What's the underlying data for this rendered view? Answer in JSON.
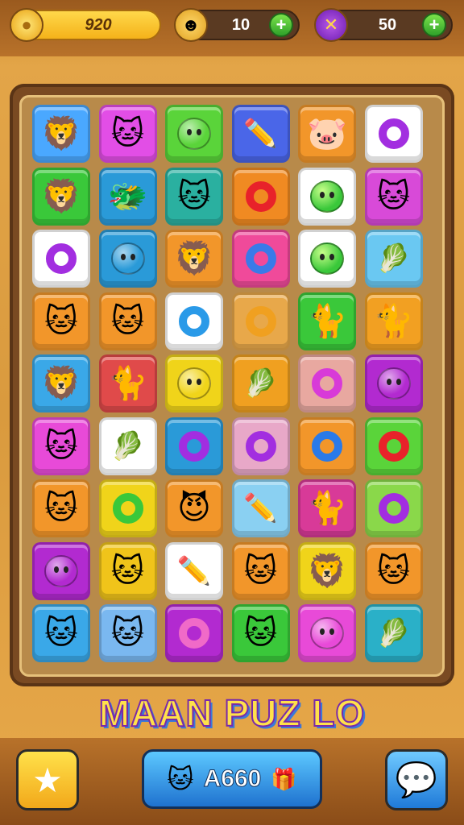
{
  "hud": {
    "coins": {
      "value": "920",
      "icon": "coin-icon"
    },
    "tokens": {
      "value": "10",
      "icon": "mask-icon",
      "plus": "+"
    },
    "tools": {
      "value": "50",
      "icon": "wrench-pencil-icon",
      "plus": "+"
    }
  },
  "title": "MAAN PUZ  LO",
  "bottom": {
    "star_icon": "star-icon",
    "main_label": "A660",
    "chat_icon": "chat-bubble-icon"
  },
  "board": {
    "rows": [
      [
        {
          "kind": "cat",
          "color": "#4aa8ff",
          "glyph": "🦁"
        },
        {
          "kind": "cat",
          "color": "#e24ee6",
          "glyph": "🐱"
        },
        {
          "kind": "blob",
          "color": "#5ad43a",
          "glyph": ""
        },
        {
          "kind": "pencil",
          "color": "#4a66e8",
          "glyph": "✏️"
        },
        {
          "kind": "cat",
          "color": "#f2962a",
          "glyph": "🐷"
        },
        {
          "kind": "ring",
          "color": "#ffffff",
          "ring": "#a22ee0"
        }
      ],
      [
        {
          "kind": "cat",
          "color": "#3ac83a",
          "glyph": "🦁"
        },
        {
          "kind": "cat",
          "color": "#2a9ad8",
          "glyph": "🐲"
        },
        {
          "kind": "cat",
          "color": "#2ab0a0",
          "glyph": "🐱"
        },
        {
          "kind": "ring",
          "color": "#f08a22",
          "ring": "#e8222a"
        },
        {
          "kind": "blob",
          "color": "#ffffff",
          "glyph": ""
        },
        {
          "kind": "cat",
          "color": "#d84ad8",
          "glyph": "🐱"
        }
      ],
      [
        {
          "kind": "ring",
          "color": "#ffffff",
          "ring": "#a22ee0"
        },
        {
          "kind": "blob",
          "color": "#2a9ad8",
          "glyph": ""
        },
        {
          "kind": "cat",
          "color": "#f2962a",
          "glyph": "🦁"
        },
        {
          "kind": "ring",
          "color": "#f04a9a",
          "ring": "#3a7ae8"
        },
        {
          "kind": "blob",
          "color": "#ffffff",
          "glyph": ""
        },
        {
          "kind": "pencil",
          "color": "#6ac8f2",
          "glyph": "🥬"
        }
      ],
      [
        {
          "kind": "cat",
          "color": "#f2962a",
          "glyph": "🐱"
        },
        {
          "kind": "cat",
          "color": "#f2962a",
          "glyph": "🐱"
        },
        {
          "kind": "ring",
          "color": "#ffffff",
          "ring": "#2a9ae8"
        },
        {
          "kind": "ring",
          "color": "#e8a84a",
          "ring": "#f0a020"
        },
        {
          "kind": "cat",
          "color": "#3ac83a",
          "glyph": "🐈"
        },
        {
          "kind": "cat",
          "color": "#f2a022",
          "glyph": "🐈"
        }
      ],
      [
        {
          "kind": "cat",
          "color": "#3aa8e8",
          "glyph": "🦁"
        },
        {
          "kind": "cat",
          "color": "#e04a4a",
          "glyph": "🐈"
        },
        {
          "kind": "blob",
          "color": "#f0d41a",
          "glyph": ""
        },
        {
          "kind": "pencil",
          "color": "#f0a020",
          "glyph": "🥬"
        },
        {
          "kind": "ring",
          "color": "#e8a8a0",
          "ring": "#d83ad8"
        },
        {
          "kind": "blob",
          "color": "#b22ad0",
          "glyph": ""
        }
      ],
      [
        {
          "kind": "cat",
          "color": "#e84ad8",
          "glyph": "🐱"
        },
        {
          "kind": "pencil",
          "color": "#ffffff",
          "glyph": "🥬"
        },
        {
          "kind": "ring",
          "color": "#2a9ad8",
          "ring": "#a22ee0"
        },
        {
          "kind": "ring",
          "color": "#e8a8c8",
          "ring": "#a22ee0"
        },
        {
          "kind": "ring",
          "color": "#f2962a",
          "ring": "#2a7ae8"
        },
        {
          "kind": "ring",
          "color": "#5ad43a",
          "ring": "#e8222a"
        }
      ],
      [
        {
          "kind": "cat",
          "color": "#f2962a",
          "glyph": "🐱"
        },
        {
          "kind": "ring",
          "color": "#f0d41a",
          "ring": "#3ac83a"
        },
        {
          "kind": "cat",
          "color": "#f2962a",
          "glyph": "😈"
        },
        {
          "kind": "pencil",
          "color": "#8ad0f2",
          "glyph": "✏️"
        },
        {
          "kind": "cat",
          "color": "#d83a98",
          "glyph": "🐈"
        },
        {
          "kind": "ring",
          "color": "#8ad84a",
          "ring": "#a22ee0"
        }
      ],
      [
        {
          "kind": "blob",
          "color": "#b22ad0",
          "glyph": ""
        },
        {
          "kind": "cat",
          "color": "#f0c41a",
          "glyph": "🐱"
        },
        {
          "kind": "pencil",
          "color": "#ffffff",
          "glyph": "✏️"
        },
        {
          "kind": "cat",
          "color": "#f2962a",
          "glyph": "🐱"
        },
        {
          "kind": "cat",
          "color": "#f0d41a",
          "glyph": "🦁"
        },
        {
          "kind": "cat",
          "color": "#f2962a",
          "glyph": "🐱"
        }
      ],
      [
        {
          "kind": "cat",
          "color": "#3aa8e8",
          "glyph": "🐱"
        },
        {
          "kind": "cat",
          "color": "#7ab8f0",
          "glyph": "🐱"
        },
        {
          "kind": "ring",
          "color": "#b22ad0",
          "ring": "#f06ac8"
        },
        {
          "kind": "cat",
          "color": "#3ac83a",
          "glyph": "🐱"
        },
        {
          "kind": "blob",
          "color": "#e84ad8",
          "glyph": ""
        },
        {
          "kind": "pencil",
          "color": "#2ab0c8",
          "glyph": "🥬"
        }
      ]
    ]
  }
}
